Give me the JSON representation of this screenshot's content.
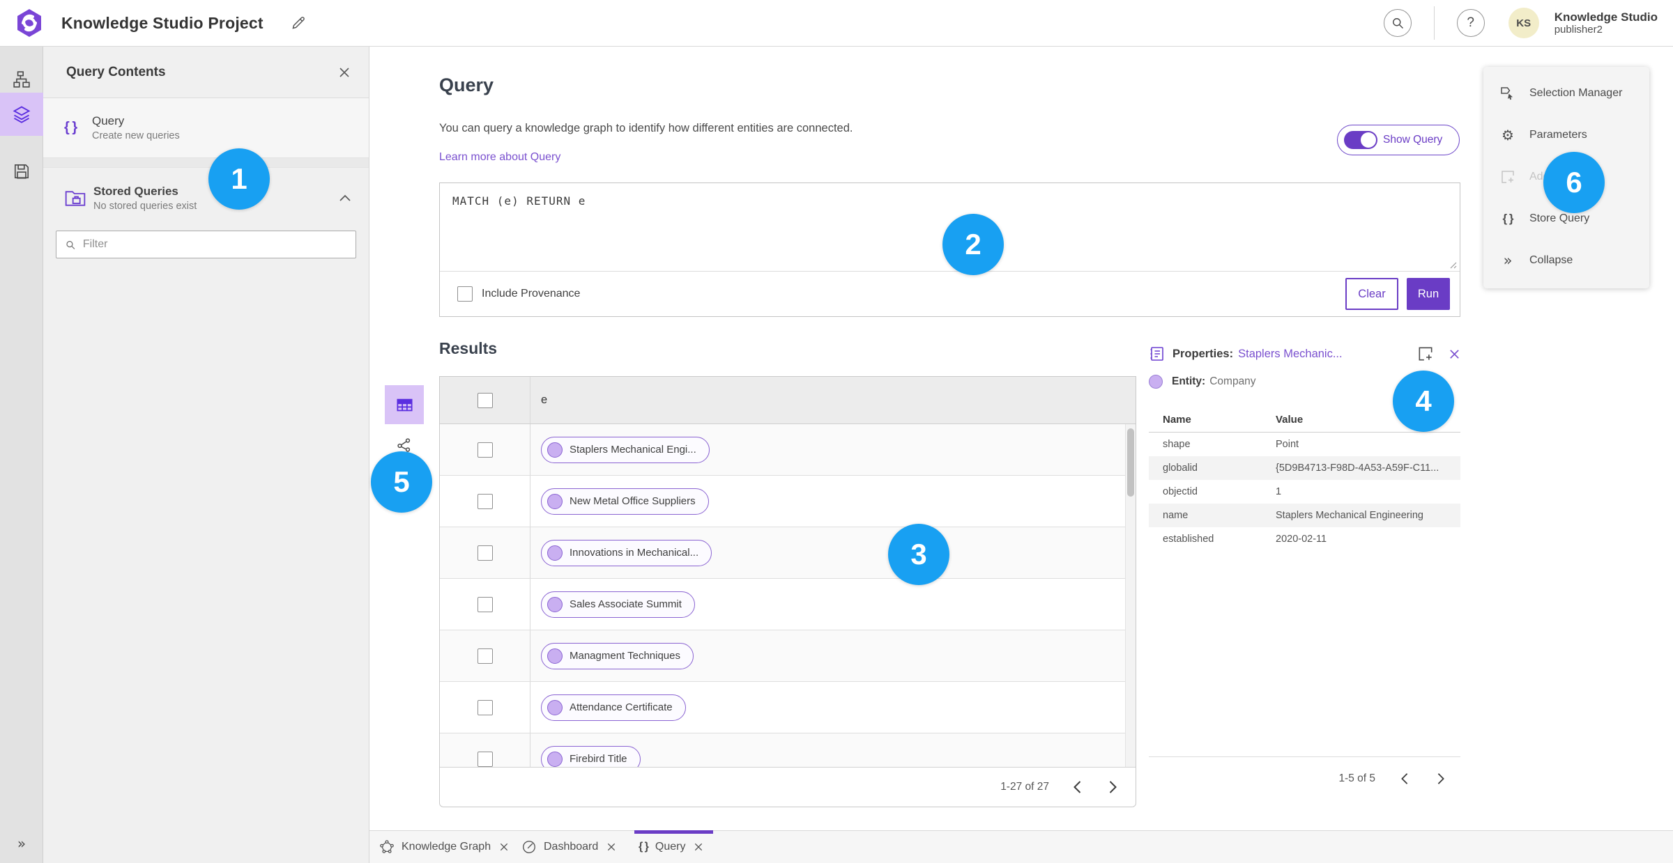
{
  "colors": {
    "accent_purple": "#6a3cc5",
    "accent_light_purple": "#d9c3f7",
    "link_purple": "#7a50cf",
    "annotation_blue": "#18a0f2",
    "avatar_yellow": "#f2edc9"
  },
  "header": {
    "title": "Knowledge Studio Project",
    "help_glyph": "?",
    "user": {
      "initials": "KS",
      "name": "Knowledge Studio",
      "role": "publisher2"
    }
  },
  "rail": {
    "expand_glyph": "»"
  },
  "contents_panel": {
    "title": "Query Contents",
    "query_item": {
      "icon_glyph": "{ }",
      "label": "Query",
      "description": "Create new queries"
    },
    "stored_item": {
      "label": "Stored Queries",
      "description": "No stored queries exist"
    },
    "filter_placeholder": "Filter"
  },
  "query_section": {
    "title": "Query",
    "description": "You can query a knowledge graph to identify how different entities are connected.",
    "learn_more_label": "Learn more about Query",
    "show_query_label": "Show Query",
    "query_text": "MATCH (e) RETURN e",
    "include_provenance_label": "Include Provenance",
    "clear_label": "Clear",
    "run_label": "Run"
  },
  "results": {
    "title": "Results",
    "column_header": "e",
    "rows": [
      "Staplers Mechanical Engi...",
      "New Metal Office Suppliers",
      "Innovations in Mechanical...",
      "Sales Associate Summit",
      "Managment Techniques",
      "Attendance Certificate",
      "Firebird Title"
    ],
    "pagination": "1-27 of 27"
  },
  "properties": {
    "title": "Properties:",
    "entity_link": "Staplers Mechanic...",
    "entity_label": "Entity:",
    "entity_type": "Company",
    "name_header": "Name",
    "value_header": "Value",
    "rows": [
      {
        "name": "shape",
        "value": "Point"
      },
      {
        "name": "globalid",
        "value": "{5D9B4713-F98D-4A53-A59F-C11..."
      },
      {
        "name": "objectid",
        "value": "1"
      },
      {
        "name": "name",
        "value": "Staplers Mechanical Engineering"
      },
      {
        "name": "established",
        "value": "2020-02-11"
      }
    ],
    "pagination": "1-5 of 5"
  },
  "side_menu": {
    "items": [
      {
        "label": "Selection Manager"
      },
      {
        "label": "Parameters",
        "icon_glyph": "⚙"
      },
      {
        "label": "Add"
      },
      {
        "label": "Store Query",
        "icon_glyph": "{ }"
      },
      {
        "label": "Collapse",
        "icon_glyph": "»"
      }
    ]
  },
  "tabs": [
    {
      "label": "Knowledge Graph"
    },
    {
      "label": "Dashboard"
    },
    {
      "label": "Query",
      "icon_glyph": "{ }"
    }
  ],
  "annotations": [
    "1",
    "2",
    "3",
    "4",
    "5",
    "6"
  ]
}
